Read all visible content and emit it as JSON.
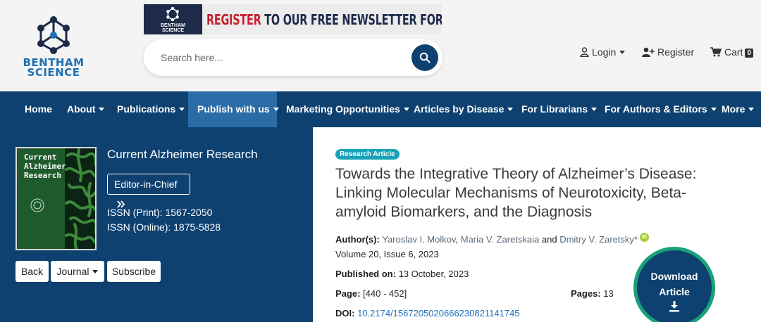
{
  "brand": {
    "logo_line1": "BENTHAM",
    "logo_line2": "SCIENCE"
  },
  "banner": {
    "small_line1": "BENTHAM",
    "small_line2": "SCIENCE",
    "text_red": "REGISTER",
    "text_rest": " TO OUR FREE NEWSLETTER FOR UPDATES"
  },
  "search": {
    "placeholder": "Search here..."
  },
  "topnav": {
    "login": "Login",
    "register": "Register",
    "cart": "Cart",
    "cart_count": "0"
  },
  "mainnav": {
    "items": [
      {
        "label": "Home"
      },
      {
        "label": "About"
      },
      {
        "label": "Publications"
      },
      {
        "label": "Publish with us"
      },
      {
        "label": "Marketing Opportunities"
      },
      {
        "label": "Articles by Disease"
      },
      {
        "label": "For Librarians"
      },
      {
        "label": "For Authors & Editors"
      },
      {
        "label": "More"
      }
    ]
  },
  "journal": {
    "name": "Current Alzheimer Research",
    "cover_title_line1": "Current",
    "cover_title_line2": "Alzheimer Research",
    "editor_button": "Editor-in-Chief",
    "issn_print": "ISSN (Print): 1567-2050",
    "issn_online": "ISSN (Online): 1875-5828",
    "back_button": "Back",
    "journal_button": "Journal",
    "subscribe_button": "Subscribe"
  },
  "article": {
    "type_tag": "Research Article",
    "title": "Towards the Integrative Theory of Alzheimer’s Disease: Linking Molecular Mechanisms of Neurotoxicity, Beta-amyloid Biomarkers, and the Diagnosis",
    "authors_label": "Author(s):",
    "author1": "Yaroslav I. Molkov",
    "author2": "Maria V. Zaretskaia",
    "and_text": "and",
    "author3": "Dmitry V. Zaretsky*",
    "orcid_label": "iD",
    "volume_issue": "Volume 20, Issue 6, 2023",
    "published_label": "Published on:",
    "published_date": "13 October, 2023",
    "page_label": "Page:",
    "page_range": "[440 - 452]",
    "pages_label": "Pages:",
    "pages_count": "13",
    "doi_label": "DOI:",
    "doi_value": "10.2174/1567205020666230821141745",
    "download_line1": "Download",
    "download_line2": "Article"
  }
}
